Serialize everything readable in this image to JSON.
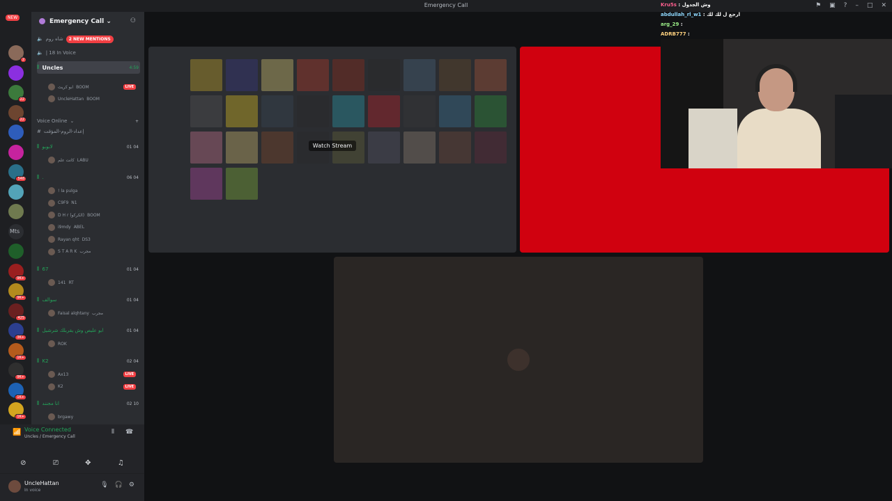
{
  "window": {
    "title": "Emergency Call",
    "icons": [
      "inbox-icon",
      "screen-icon",
      "help-icon",
      "minimize-icon",
      "maximize-icon",
      "close-icon"
    ]
  },
  "servers": {
    "new_label": "NEW",
    "items": [
      {
        "badge": "2",
        "color": "#8a6a5a"
      },
      {
        "badge": "",
        "color": "#8b2fe0"
      },
      {
        "badge": "22",
        "color": "#3c7a3c"
      },
      {
        "badge": "22",
        "color": "#6d4530"
      },
      {
        "badge": "",
        "color": "#2e5dbb"
      },
      {
        "badge": "",
        "color": "#c6239e"
      },
      {
        "badge": "548",
        "color": "#2a6f89"
      },
      {
        "badge": "",
        "color": "#53a3b8"
      },
      {
        "badge": "",
        "color": "#6f7a4f"
      },
      {
        "badge": "",
        "color": "#2b2d31",
        "text": "Mts"
      },
      {
        "badge": "",
        "color": "#1f5f2a"
      },
      {
        "badge": "9K+",
        "color": "#9a1f1f"
      },
      {
        "badge": "9K+",
        "color": "#b38a1d"
      },
      {
        "badge": "425",
        "color": "#6a2020"
      },
      {
        "badge": "3K+",
        "color": "#2c3f8f"
      },
      {
        "badge": "1K+",
        "color": "#b45b1c"
      },
      {
        "badge": "9K+",
        "color": "#2f2f2f"
      },
      {
        "badge": "1K+",
        "color": "#1d62b5"
      },
      {
        "badge": "1K+",
        "color": "#d3a51f"
      }
    ]
  },
  "guild": {
    "name": "Emergency Call"
  },
  "channels": {
    "top_channel": "شاه روم",
    "mentions": "2 NEW MENTIONS",
    "in_voice": "| 18 In Voice",
    "selected": {
      "name": "Uncles",
      "time": "4:59"
    },
    "uncles_users": [
      {
        "name": "ابو كريث",
        "tag": "BOOM",
        "live": "LIVE"
      },
      {
        "name": "UncleHattan",
        "tag": "BOOM",
        "live": ""
      }
    ],
    "category": "Voice Online",
    "text_channel": "إعداد-الروم-المؤقت",
    "groups": [
      {
        "name": "لابوبو",
        "count": "01 04",
        "users": [
          {
            "name": "كانت علم",
            "tag": "LABU",
            "live": ""
          }
        ]
      },
      {
        "name": ".",
        "count": "06 04",
        "users": [
          {
            "name": "! la pulga",
            "tag": "",
            "live": ""
          },
          {
            "name": "C9F9",
            "tag": "N1",
            "live": ""
          },
          {
            "name": "D H r (الكركو)",
            "tag": "BOOM",
            "live": ""
          },
          {
            "name": "i9mdy",
            "tag": "ABEL",
            "live": ""
          },
          {
            "name": "Rayan qht",
            "tag": "DS3",
            "live": ""
          },
          {
            "name": "S T A R K",
            "tag": "مجرب",
            "live": ""
          }
        ]
      },
      {
        "name": "67",
        "count": "01 04",
        "users": [
          {
            "name": "141",
            "tag": "RT",
            "live": ""
          }
        ]
      },
      {
        "name": "سوالف",
        "count": "01 04",
        "users": [
          {
            "name": "Faisal alqhtany",
            "tag": "مجرب",
            "live": ""
          }
        ]
      },
      {
        "name": "ابو عليص وش يقربلك شرشيل",
        "count": "01 04",
        "users": [
          {
            "name": "ROK",
            "tag": "",
            "live": ""
          }
        ]
      },
      {
        "name": "K2",
        "count": "02 04",
        "users": [
          {
            "name": "Ax13",
            "tag": "",
            "live": "LIVE"
          },
          {
            "name": "K2",
            "tag": "",
            "live": "LIVE"
          }
        ]
      },
      {
        "name": "انا مجنند",
        "count": "02 10",
        "users": [
          {
            "name": "brgawy",
            "tag": "",
            "live": ""
          }
        ]
      }
    ]
  },
  "voice": {
    "status": "Voice Connected",
    "path": "Uncles / Emergency Call"
  },
  "user": {
    "name": "UncleHattan",
    "status": "In voice"
  },
  "stage": {
    "watch_stream": "Watch Stream",
    "game_colors": [
      "#d8b428",
      "#3b3a8f",
      "#e8d87a",
      "#c43a2a",
      "#9a2b1c",
      "#2a2a2a",
      "#4c6a86",
      "#6b4a2a",
      "#b85a3a",
      "#5a5a5a",
      "#f0d020",
      "#3a4a5a",
      "#2a2a2a",
      "#2aa6b8",
      "#c8202a",
      "#3a3a3a",
      "#3a7aa0",
      "#2c9a3a",
      "#d87a9a",
      "#e0c878",
      "#8a4a2a",
      "#2a2a2a",
      "#6a6a3a",
      "#5a5a6a",
      "#9a8a7a",
      "#7a4a3a",
      "#6a2a3a",
      "#c04ab0",
      "#8abf3a"
    ]
  },
  "overlay_chat": [
    {
      "user": "Kru5s",
      "text": "وش الجدول",
      "color": "#ff5f8f"
    },
    {
      "user": "abdullah_rl_w1",
      "text": "ارجع ل لك لك",
      "color": "#8fd9ff"
    },
    {
      "user": "arg_29",
      "text": "",
      "color": "#9df089"
    },
    {
      "user": "ADRB777",
      "text": "",
      "color": "#ffd27f"
    }
  ]
}
